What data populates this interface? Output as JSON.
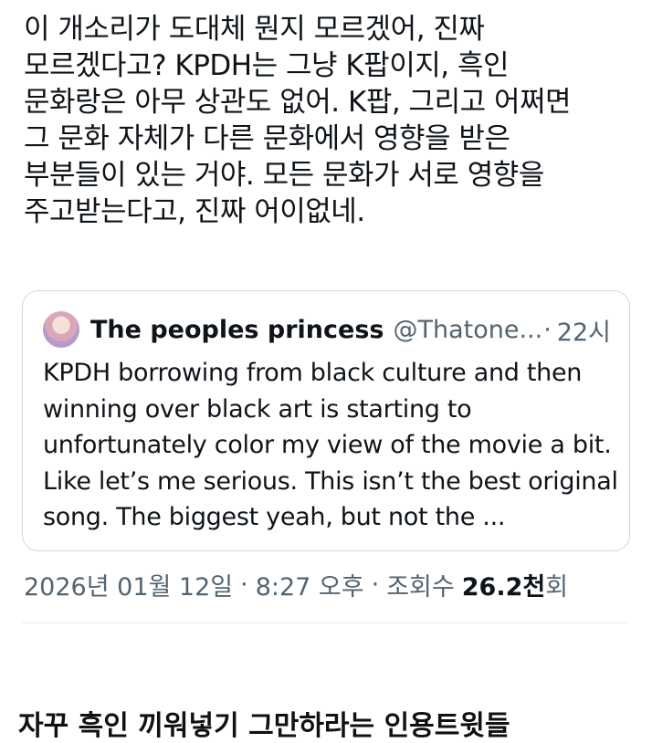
{
  "tweet": {
    "text": "이 개소리가 도대체 뭔지 모르겠어, 진짜\n모르겠다고? KPDH는 그냥 K팝이지, 흑인\n문화랑은 아무 상관도 없어. K팝, 그리고 어쩌면\n그 문화 자체가 다른 문화에서 영향을 받은\n부분들이 있는 거야. 모든 문화가 서로 영향을\n주고받는다고, 진짜 어이없네."
  },
  "quote": {
    "author_name": "The peoples princess",
    "author_handle": "@Thatone...",
    "dot": "·",
    "time": "22시",
    "text": "KPDH borrowing from black culture and then winning over black art is starting to unfortunately color my view of the movie a bit. Like let’s me serious. This isn’t the best original song. The biggest yeah, but not the ..."
  },
  "meta": {
    "date": "2026년 01월 12일",
    "sep1": "·",
    "time": "8:27 오후",
    "sep2": "·",
    "views_label": "조회수",
    "views_count": "26.2천",
    "views_suffix": "회"
  },
  "caption": "자꾸 흑인 끼워넣기 그만하라는 인용트윗들"
}
